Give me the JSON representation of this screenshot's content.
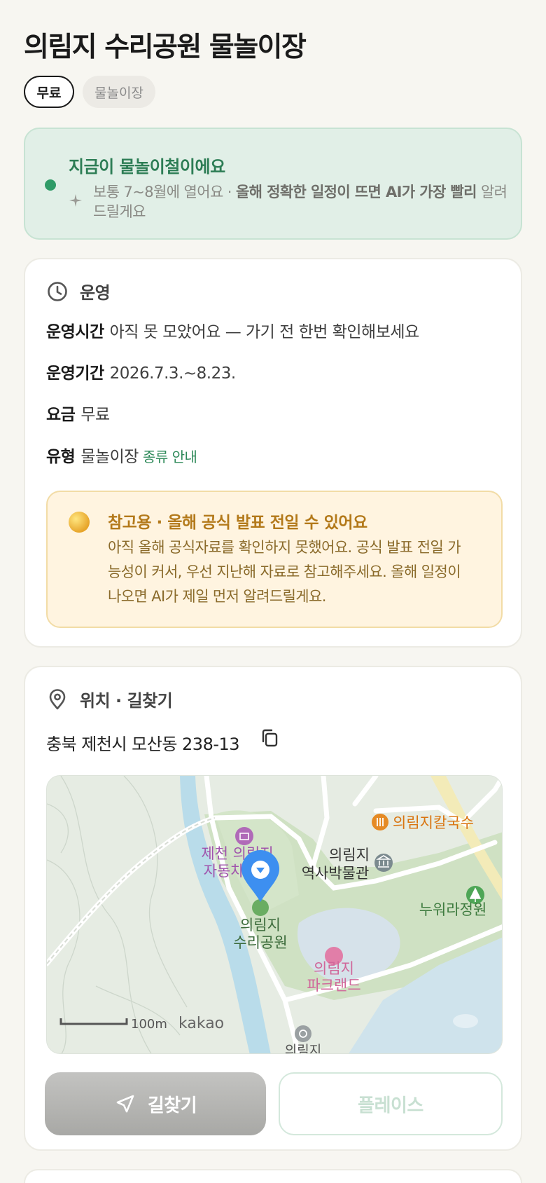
{
  "page": {
    "title": "의림지 수리공원 물놀이장",
    "chips": {
      "price": "무료",
      "category": "물놀이장"
    }
  },
  "season": {
    "headline": "지금이 물놀이철이에요",
    "desc_prefix": "보통 7~8월에 열어요 · ",
    "desc_bold": "올해 정확한 일정이 뜨면 AI가 가장 빨리",
    "desc_suffix": " 알려드릴게요"
  },
  "operation": {
    "section_title": "운영",
    "rows": [
      {
        "label": "운영시간",
        "value": "아직 못 모았어요 — 가기 전 한번 확인해보세요"
      },
      {
        "label": "운영기간",
        "value": "2026.7.3.~8.23."
      },
      {
        "label": "요금",
        "value": "무료"
      },
      {
        "label": "유형",
        "value": "물놀이장",
        "link": "종류 안내"
      }
    ],
    "notice": {
      "title": "참고용 · 올해 공식 발표 전일 수 있어요",
      "body": "아직 올해 공식자료를 확인하지 못했어요. 공식 발표 전일 가능성이 커서, 우선 지난해 자료로 참고해주세요. 올해 일정이 나오면 AI가 제일 먼저 알려드릴게요."
    }
  },
  "location": {
    "section_title": "위치 · 길찾기",
    "address": "충북 제천시 모산동 238-13",
    "map": {
      "labels": {
        "kalguksu": "의림지칼국수",
        "museum_1": "의림지",
        "museum_2": "역사박물관",
        "jecheon_1": "제천 의림지",
        "jecheon_2": "자동차극장",
        "park_1": "의림지",
        "park_2": "수리공원",
        "nuwora": "누워라정원",
        "parkland_1": "의림지",
        "parkland_2": "파크랜드",
        "bottom": "의림지",
        "scale": "100m",
        "brand": "kakao"
      }
    },
    "buttons": {
      "route": "길찾기",
      "place": "플레이스"
    }
  },
  "colors": {
    "accent_green": "#2f9b67",
    "notice_orange": "#b3791a",
    "map_pin": "#3d8ff0"
  }
}
